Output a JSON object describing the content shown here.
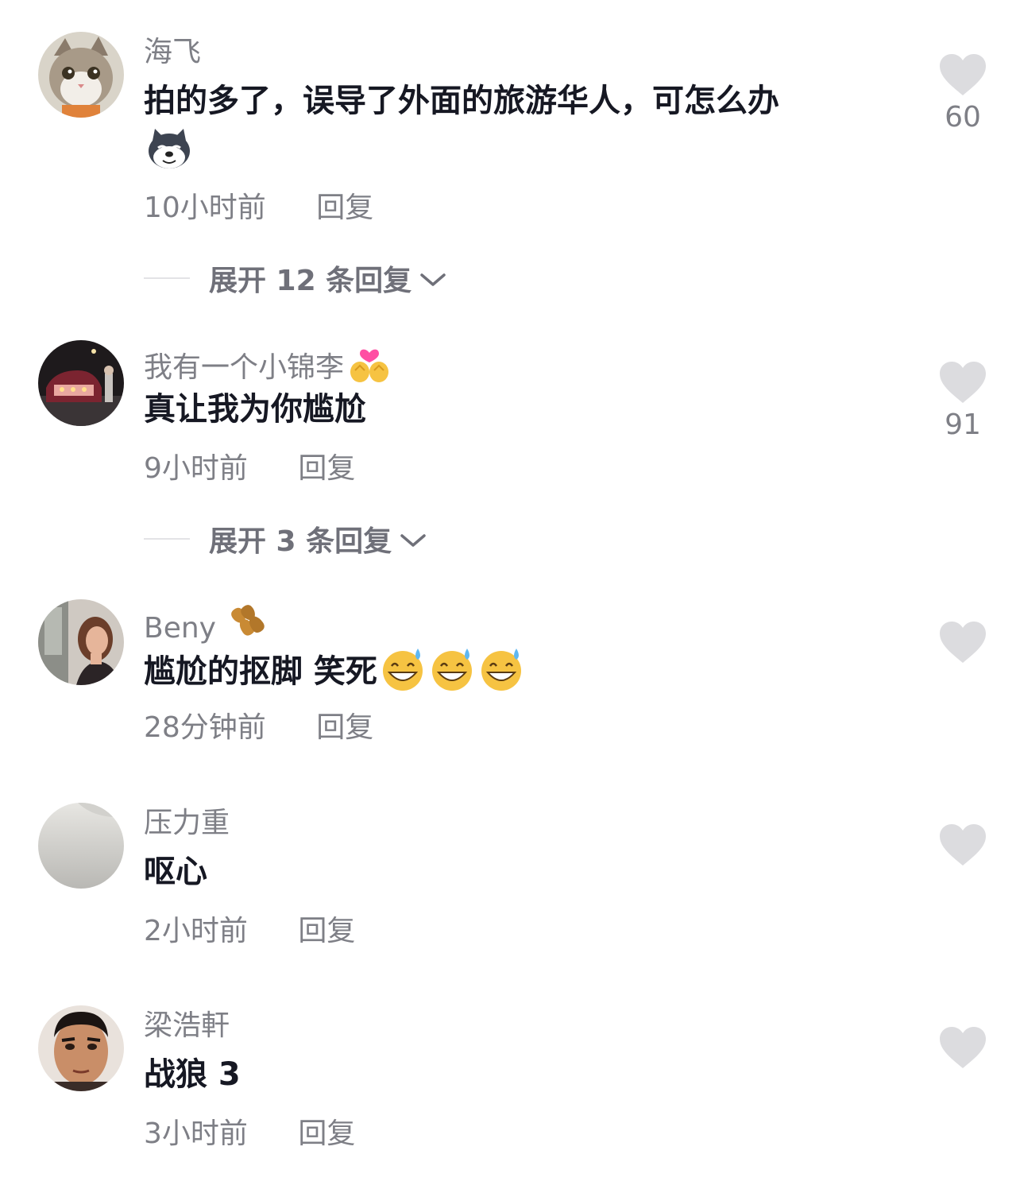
{
  "colors": {
    "text_primary": "#161823",
    "text_secondary": "#7e7f86",
    "heart": "#dcdcdf",
    "background": "#ffffff"
  },
  "comments": [
    {
      "author": "海飞",
      "text": "拍的多了，误导了外面的旅游华人，可怎么办",
      "text_emoji": "doge-wolf-emoji",
      "time": "10小时前",
      "reply": "回复",
      "likes": "60",
      "expand": "展开 12 条回复"
    },
    {
      "author": "我有一个小锦李",
      "author_emoji": "hugging-hearts-emoji",
      "text": "真让我为你尴尬",
      "time": "9小时前",
      "reply": "回复",
      "likes": "91",
      "expand": "展开 3 条回复"
    },
    {
      "author": "Beny",
      "author_emoji": "peanut-emoji",
      "text": "尴尬的抠脚 笑死",
      "text_emoji": "grin-sweat-emoji",
      "time": "28分钟前",
      "reply": "回复"
    },
    {
      "author": "压力重",
      "text": "呕心",
      "time": "2小时前",
      "reply": "回复"
    },
    {
      "author": "梁浩軒",
      "text": "战狼 3",
      "time": "3小时前",
      "reply": "回复"
    }
  ]
}
